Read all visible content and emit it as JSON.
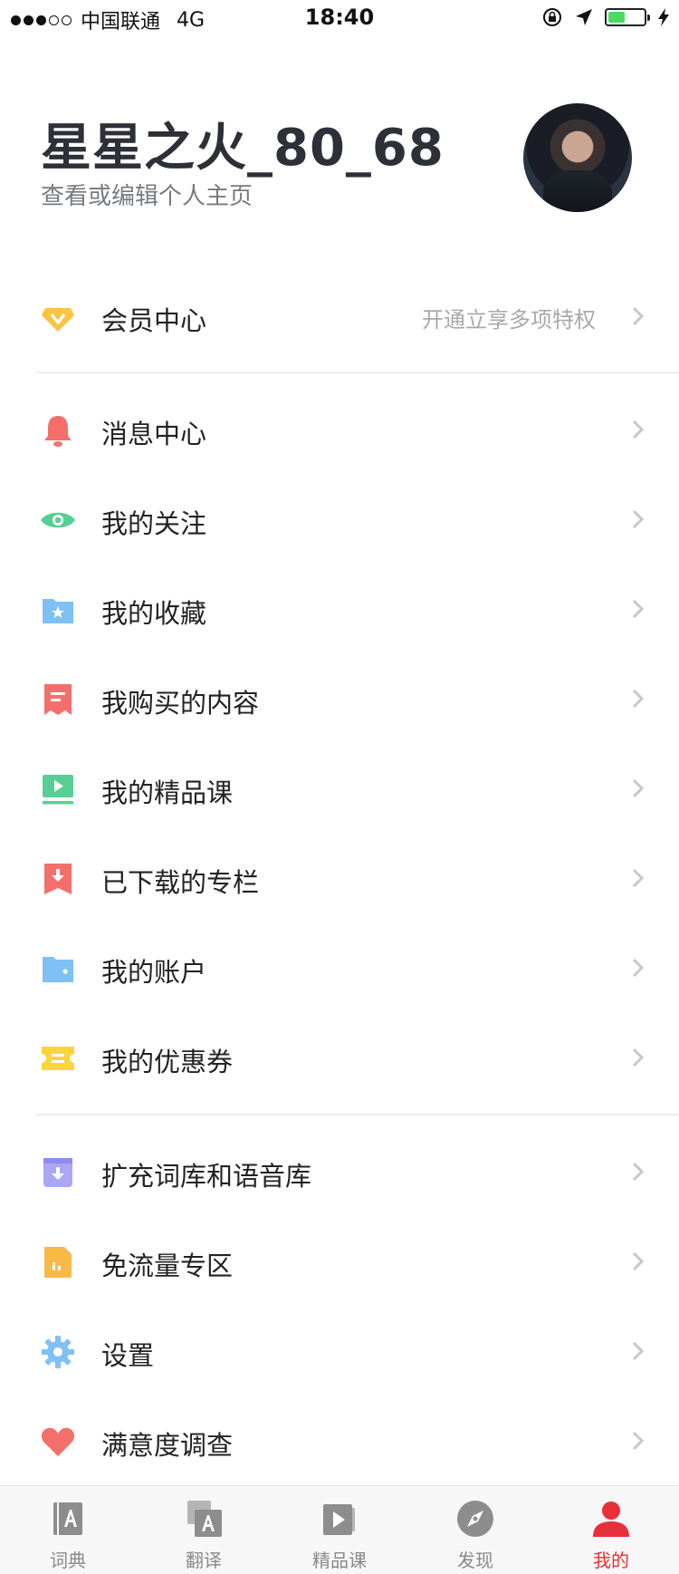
{
  "status_bar": {
    "carrier": "中国联通",
    "network": "4G",
    "time": "18:40"
  },
  "profile": {
    "username": "星星之火_80_68",
    "link_text": "查看或编辑个人主页"
  },
  "menu": {
    "vip": {
      "label": "会员中心",
      "subtitle": "开通立享多项特权",
      "icon": "vip-diamond-icon",
      "color": "#f9c442"
    },
    "group1": [
      {
        "label": "消息中心",
        "icon": "bell-icon",
        "color": "#f46f6b"
      },
      {
        "label": "我的关注",
        "icon": "eye-icon",
        "color": "#57cf94"
      },
      {
        "label": "我的收藏",
        "icon": "star-folder-icon",
        "color": "#7fc0f5"
      },
      {
        "label": "我购买的内容",
        "icon": "receipt-icon",
        "color": "#f46f6b"
      },
      {
        "label": "我的精品课",
        "icon": "video-play-icon",
        "color": "#57cf94"
      },
      {
        "label": "已下载的专栏",
        "icon": "download-bookmark-icon",
        "color": "#f46f6b"
      },
      {
        "label": "我的账户",
        "icon": "wallet-icon",
        "color": "#7fc0f5"
      },
      {
        "label": "我的优惠券",
        "icon": "coupon-icon",
        "color": "#f9d53a"
      }
    ],
    "group2": [
      {
        "label": "扩充词库和语音库",
        "icon": "download-box-icon",
        "color": "#aaa7f5"
      },
      {
        "label": "免流量专区",
        "icon": "data-free-icon",
        "color": "#f9b947"
      },
      {
        "label": "设置",
        "icon": "gear-icon",
        "color": "#7fc0f5"
      },
      {
        "label": "满意度调查",
        "icon": "heart-icon",
        "color": "#f46f6b"
      }
    ]
  },
  "tabs": [
    {
      "label": "词典",
      "icon": "dictionary-icon",
      "active": false
    },
    {
      "label": "翻译",
      "icon": "translate-icon",
      "active": false
    },
    {
      "label": "精品课",
      "icon": "course-play-icon",
      "active": false
    },
    {
      "label": "发现",
      "icon": "compass-icon",
      "active": false
    },
    {
      "label": "我的",
      "icon": "person-icon",
      "active": true
    }
  ],
  "colors": {
    "accent": "#e8303b",
    "chevron": "#c7c7cc",
    "divider": "#ececec"
  }
}
